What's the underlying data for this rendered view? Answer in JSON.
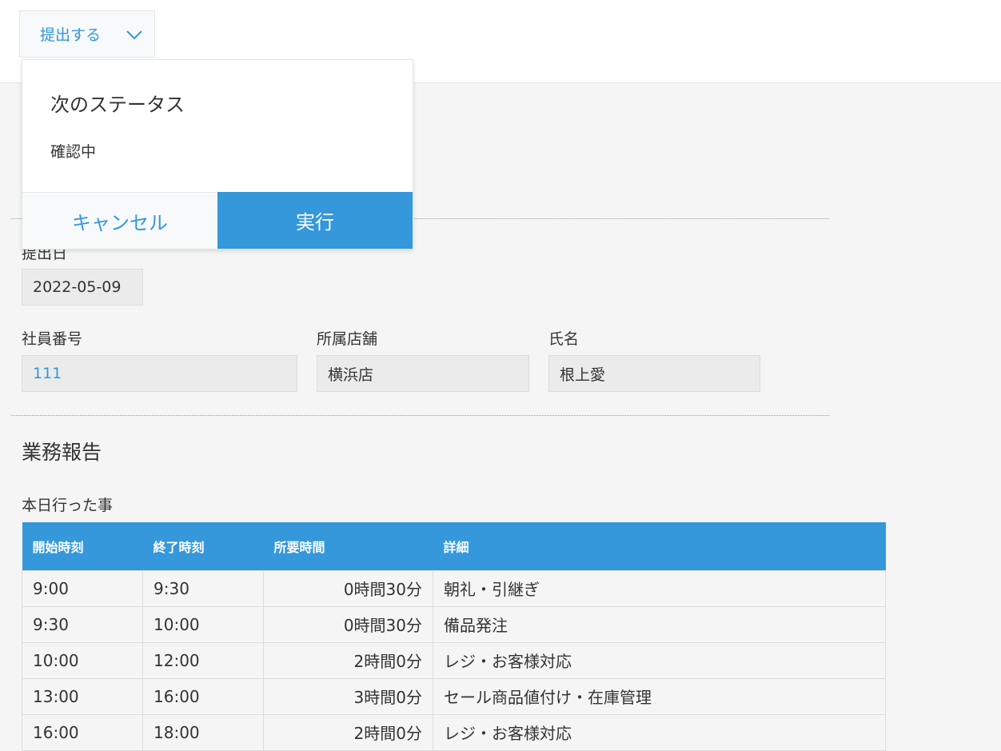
{
  "header": {
    "action_button_label": "提出する"
  },
  "status_popup": {
    "title": "次のステータス",
    "next_status": "確認中",
    "cancel_label": "キャンセル",
    "execute_label": "実行"
  },
  "form": {
    "submit_date": {
      "label": "提出日",
      "value": "2022-05-09"
    },
    "employee_number": {
      "label": "社員番号",
      "value": "111"
    },
    "store": {
      "label": "所属店舗",
      "value": "横浜店"
    },
    "name": {
      "label": "氏名",
      "value": "根上愛"
    }
  },
  "report": {
    "section_title": "業務報告",
    "table_label": "本日行った事",
    "columns": [
      "開始時刻",
      "終了時刻",
      "所要時間",
      "詳細"
    ],
    "rows": [
      [
        "9:00",
        "9:30",
        "0時間30分",
        "朝礼・引継ぎ"
      ],
      [
        "9:30",
        "10:00",
        "0時間30分",
        "備品発注"
      ],
      [
        "10:00",
        "12:00",
        "2時間0分",
        "レジ・お客様対応"
      ],
      [
        "13:00",
        "16:00",
        "3時間0分",
        "セール商品値付け・在庫管理"
      ],
      [
        "16:00",
        "18:00",
        "2時間0分",
        "レジ・お客様対応"
      ]
    ]
  },
  "colors": {
    "accent": "#3498db",
    "background": "#f5f5f5"
  }
}
